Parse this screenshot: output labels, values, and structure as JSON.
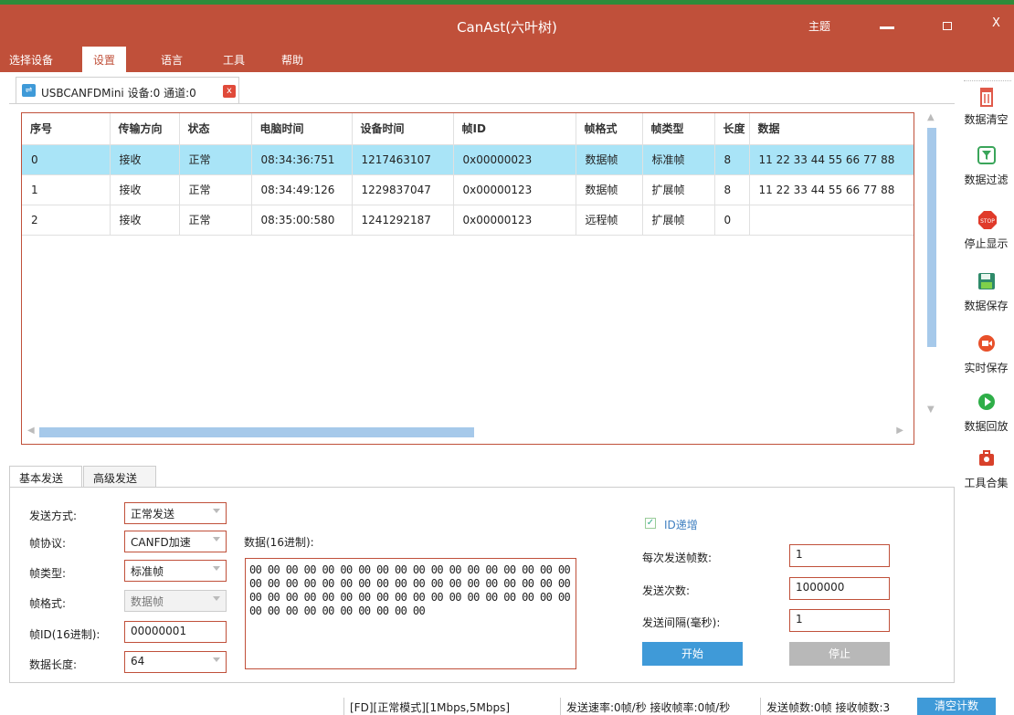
{
  "window": {
    "title": "CanAst(六叶树)",
    "theme_label": "主题",
    "minimize_label": "",
    "close_label": "X"
  },
  "menu": {
    "items": [
      "选择设备",
      "设置",
      "语言",
      "工具",
      "帮助"
    ],
    "active": "设置"
  },
  "device_tab": {
    "label": "USBCANFDMini 设备:0 通道:0",
    "close_label": "x"
  },
  "grid": {
    "columns": [
      "序号",
      "传输方向",
      "状态",
      "电脑时间",
      "设备时间",
      "帧ID",
      "帧格式",
      "帧类型",
      "长度",
      "数据"
    ],
    "rows": [
      [
        "0",
        "接收",
        "正常",
        "08:34:36:751",
        "1217463107",
        "0x00000023",
        "数据帧",
        "标准帧",
        "8",
        "11 22 33 44 55 66 77 88"
      ],
      [
        "1",
        "接收",
        "正常",
        "08:34:49:126",
        "1229837047",
        "0x00000123",
        "数据帧",
        "扩展帧",
        "8",
        "11 22 33 44 55 66 77 88"
      ],
      [
        "2",
        "接收",
        "正常",
        "08:35:00:580",
        "1241292187",
        "0x00000123",
        "远程帧",
        "扩展帧",
        "0",
        ""
      ]
    ],
    "selected_row": 0
  },
  "sidebar": {
    "items": [
      {
        "label": "数据清空",
        "icon": "trash-icon"
      },
      {
        "label": "数据过滤",
        "icon": "filter-icon"
      },
      {
        "label": "停止显示",
        "icon": "stop-icon"
      },
      {
        "label": "数据保存",
        "icon": "save-icon"
      },
      {
        "label": "实时保存",
        "icon": "record-icon"
      },
      {
        "label": "数据回放",
        "icon": "play-icon"
      },
      {
        "label": "工具合集",
        "icon": "toolbox-icon"
      }
    ]
  },
  "send_tabs": [
    "基本发送",
    "高级发送"
  ],
  "send_form": {
    "mode_label": "发送方式:",
    "mode_value": "正常发送",
    "protocol_label": "帧协议:",
    "protocol_value": "CANFD加速",
    "frame_type_label": "帧类型:",
    "frame_type_value": "标准帧",
    "frame_format_label": "帧格式:",
    "frame_format_value": "数据帧",
    "frame_id_label": "帧ID(16进制):",
    "frame_id_value": "00000001",
    "data_length_label": "数据长度:",
    "data_length_value": "64",
    "data_label": "数据(16进制):",
    "data_value": "00 00 00 00 00 00 00 00 00 00 00 00 00 00 00 00 00 00\n00 00 00 00 00 00 00 00 00 00 00 00 00 00 00 00 00 00\n00 00 00 00 00 00 00 00 00 00 00 00 00 00 00 00 00 00\n00 00 00 00 00 00 00 00 00 00",
    "id_increment_label": "ID递增",
    "id_increment_checked": true,
    "frames_per_send_label": "每次发送帧数:",
    "frames_per_send_value": "1",
    "send_count_label": "发送次数:",
    "send_count_value": "1000000",
    "interval_label": "发送间隔(毫秒):",
    "interval_value": "1",
    "start_label": "开始",
    "stop_label": "停止"
  },
  "status_bar": {
    "mode": "[FD][正常模式][1Mbps,5Mbps]",
    "rates": "发送速率:0帧/秒  接收帧率:0帧/秒",
    "counts": "发送帧数:0帧  接收帧数:3",
    "clear_label": "清空计数"
  },
  "colors": {
    "accent": "#c0503a",
    "selection": "#a9e4f7",
    "button_blue": "#3f9ad8"
  }
}
